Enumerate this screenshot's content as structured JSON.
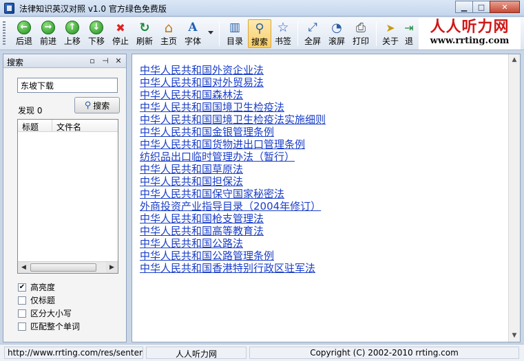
{
  "window": {
    "title": "法律知识英汉对照 v1.0 官方绿色免费版",
    "minimize": "▁",
    "maximize": "□",
    "close": "✕"
  },
  "toolbar": {
    "buttons": [
      {
        "label": "后退",
        "icon": "back-arrow-icon",
        "glyph": "←"
      },
      {
        "label": "前进",
        "icon": "forward-arrow-icon",
        "glyph": "→"
      },
      {
        "label": "上移",
        "icon": "up-arrow-icon",
        "glyph": "↑"
      },
      {
        "label": "下移",
        "icon": "down-arrow-icon",
        "glyph": "↓"
      },
      {
        "label": "停止",
        "icon": "stop-icon",
        "glyph": "✖"
      },
      {
        "label": "刷新",
        "icon": "refresh-icon",
        "glyph": "↻"
      },
      {
        "label": "主页",
        "icon": "home-icon",
        "glyph": "⌂"
      },
      {
        "label": "字体",
        "icon": "font-icon",
        "glyph": "A"
      },
      {
        "label": "目录",
        "icon": "contents-icon",
        "glyph": "▥"
      },
      {
        "label": "搜索",
        "icon": "search-icon",
        "glyph": "⚲"
      },
      {
        "label": "书签",
        "icon": "bookmark-star-icon",
        "glyph": "☆"
      },
      {
        "label": "全屏",
        "icon": "fullscreen-icon",
        "glyph": "⤢"
      },
      {
        "label": "滚屏",
        "icon": "autoscroll-icon",
        "glyph": "◔"
      },
      {
        "label": "打印",
        "icon": "printer-icon",
        "glyph": "⎙"
      },
      {
        "label": "关于",
        "icon": "about-pointer-icon",
        "glyph": "➤"
      },
      {
        "label": "退",
        "icon": "exit-icon",
        "glyph": "⇥"
      }
    ],
    "logo_main": "人人听力网",
    "logo_sub": "www.rrting.com"
  },
  "search_panel": {
    "title": "搜索",
    "pin_glyph": "ᅟ",
    "query": "东坡下载",
    "found_label": "发现 0",
    "search_button": "搜索",
    "columns": [
      "标题",
      "文件名"
    ],
    "options": [
      {
        "label": "高亮度",
        "checked": true
      },
      {
        "label": "仅标题",
        "checked": false
      },
      {
        "label": "区分大小写",
        "checked": false
      },
      {
        "label": "匹配整个单词",
        "checked": false
      }
    ]
  },
  "content": {
    "links": [
      "中华人民共和国外资企业法",
      "中华人民共和国对外贸易法",
      "中华人民共和国森林法",
      "中华人民共和国国境卫生检疫法",
      "中华人民共和国国境卫生检疫法实施细则",
      "中华人民共和国金银管理条例",
      "中华人民共和国货物进出口管理条例",
      "纺织品出口临时管理办法（暂行）",
      "中华人民共和国草原法",
      "中华人民共和国担保法",
      "中华人民共和国保守国家秘密法",
      "外商投资产业指导目录（2004年修订）",
      "中华人民共和国枪支管理法",
      "中华人民共和国高等教育法",
      "中华人民共和国公路法",
      "中华人民共和国公路管理条例",
      "中华人民共和国香港特别行政区驻军法"
    ]
  },
  "status": {
    "url": "http://www.rrting.com/res/sentenc",
    "site": "人人听力网",
    "copyright": "Copyright (C) 2002-2010 rrting.com"
  },
  "colors": {
    "link": "#1a3ec7",
    "logo_red": "#d01818",
    "toolbar_active": "#f9cf6a"
  }
}
